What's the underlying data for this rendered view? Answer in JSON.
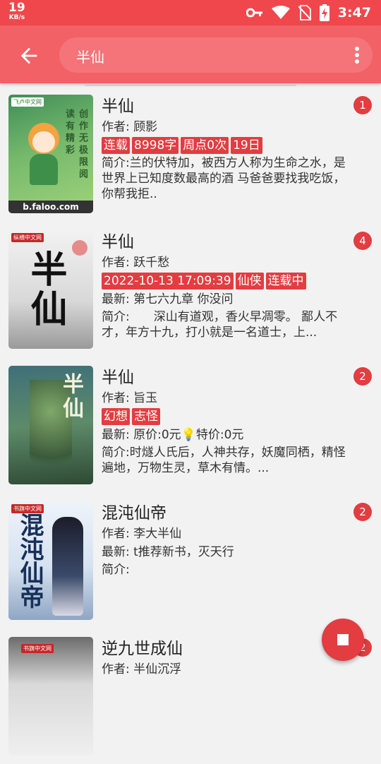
{
  "status_bar": {
    "net_speed": "19",
    "net_unit": "KB/s",
    "time": "3:47",
    "icons": [
      "key-icon",
      "wifi-icon",
      "no-sim-icon",
      "battery-charging-icon"
    ]
  },
  "app_bar": {
    "back_icon": "arrow-back-icon",
    "search_query": "半仙",
    "more_icon": "more-vertical-icon"
  },
  "colors": {
    "primary": "#f26166",
    "status_bar": "#f0474d",
    "tag": "#e33c41"
  },
  "books": [
    {
      "title": "半仙",
      "author": "作者: 顾影",
      "tags": [
        "连载",
        "8998字",
        "周点0次",
        "19日"
      ],
      "latest": "",
      "intro": "简介:兰的伏特加，被西方人称为生命之水，是世界上已知度数最高的酒 马爸爸要找我吃饭，你帮我拒..",
      "source_count": "1",
      "cover_text": "创作无极限阅读有精彩",
      "cover_brand": "b.faloo.com"
    },
    {
      "title": "半仙",
      "author": "作者: 跃千愁",
      "tags": [
        "2022-10-13 17:09:39",
        "仙侠",
        "连载中"
      ],
      "latest": "最新: 第七六九章 你没问",
      "intro": "简介:　　深山有道观，香火早凋零。 鄙人不才，年方十九，打小就是一名道士，上...",
      "source_count": "4",
      "cover_text": "半仙",
      "cover_brand": "纵横中文网"
    },
    {
      "title": "半仙",
      "author": "作者: 旨玉",
      "tags": [
        "幻想",
        "志怪"
      ],
      "latest": "最新: 原价:0元💡特价:0元",
      "intro": "简介:时燧人氏后，人神共存，妖魔同栖，精怪遍地，万物生灵，草木有情。...",
      "source_count": "2",
      "cover_text": "半仙",
      "cover_brand": ""
    },
    {
      "title": "混沌仙帝",
      "author": "作者: 李大半仙",
      "tags": [],
      "latest": "最新: t推荐新书，灭天行",
      "intro": "简介:",
      "source_count": "2",
      "cover_text": "混沌仙帝",
      "cover_brand": "书旗中文网"
    },
    {
      "title": "逆九世成仙",
      "author": "作者: 半仙沉浮",
      "tags": [],
      "latest": "",
      "intro": "",
      "source_count": "2",
      "cover_text": "",
      "cover_brand": "书旗中文网"
    }
  ],
  "fab": {
    "icon": "stop-icon"
  }
}
